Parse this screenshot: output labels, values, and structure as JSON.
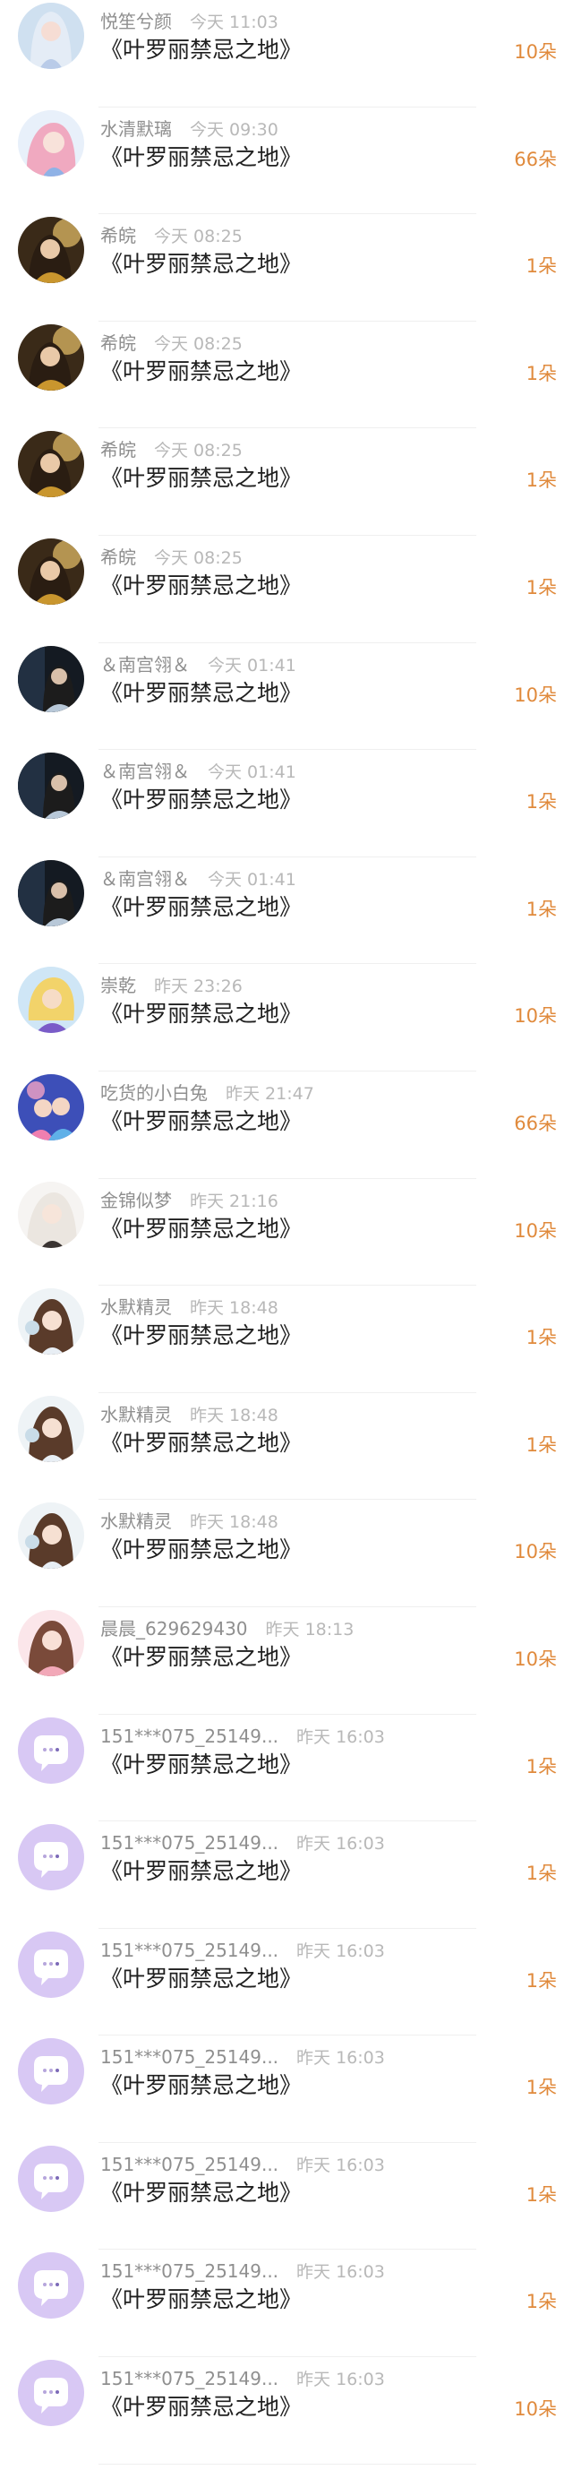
{
  "colors": {
    "amount": "#e08a3c",
    "name": "#8f8f8f",
    "time": "#b8b8b8",
    "title": "#1f1f1f",
    "placeholder_avatar": "#d8c8f4"
  },
  "rows": [
    {
      "name": "悦笙兮颜",
      "time": "今天 11:03",
      "title": "《叶罗丽禁忌之地》",
      "amount": "10朵",
      "avatar": "avatar-girl-silver-hair-icon"
    },
    {
      "name": "水清默璃",
      "time": "今天 09:30",
      "title": "《叶罗丽禁忌之地》",
      "amount": "66朵",
      "avatar": "avatar-girl-pink-hair-icon"
    },
    {
      "name": "希皖",
      "time": "今天 08:25",
      "title": "《叶罗丽禁忌之地》",
      "amount": "1朵",
      "avatar": "avatar-warrior-gold-icon"
    },
    {
      "name": "希皖",
      "time": "今天 08:25",
      "title": "《叶罗丽禁忌之地》",
      "amount": "1朵",
      "avatar": "avatar-warrior-gold-icon"
    },
    {
      "name": "希皖",
      "time": "今天 08:25",
      "title": "《叶罗丽禁忌之地》",
      "amount": "1朵",
      "avatar": "avatar-warrior-gold-icon"
    },
    {
      "name": "希皖",
      "time": "今天 08:25",
      "title": "《叶罗丽禁忌之地》",
      "amount": "1朵",
      "avatar": "avatar-warrior-gold-icon"
    },
    {
      "name": "＆南宫翎＆",
      "time": "今天 01:41",
      "title": "《叶罗丽禁忌之地》",
      "amount": "10朵",
      "avatar": "avatar-dark-portrait-icon"
    },
    {
      "name": "＆南宫翎＆",
      "time": "今天 01:41",
      "title": "《叶罗丽禁忌之地》",
      "amount": "1朵",
      "avatar": "avatar-dark-portrait-icon"
    },
    {
      "name": "＆南宫翎＆",
      "time": "今天 01:41",
      "title": "《叶罗丽禁忌之地》",
      "amount": "1朵",
      "avatar": "avatar-dark-portrait-icon"
    },
    {
      "name": "崇乾",
      "time": "昨天 23:26",
      "title": "《叶罗丽禁忌之地》",
      "amount": "10朵",
      "avatar": "avatar-blonde-hero-icon"
    },
    {
      "name": "吃货的小白兔",
      "time": "昨天 21:47",
      "title": "《叶罗丽禁忌之地》",
      "amount": "66朵",
      "avatar": "avatar-couple-blue-icon"
    },
    {
      "name": "金锦似梦",
      "time": "昨天 21:16",
      "title": "《叶罗丽禁忌之地》",
      "amount": "10朵",
      "avatar": "avatar-white-hair-girl-icon"
    },
    {
      "name": "水默精灵",
      "time": "昨天 18:48",
      "title": "《叶罗丽禁忌之地》",
      "amount": "1朵",
      "avatar": "avatar-brown-hair-girl-icon"
    },
    {
      "name": "水默精灵",
      "time": "昨天 18:48",
      "title": "《叶罗丽禁忌之地》",
      "amount": "1朵",
      "avatar": "avatar-brown-hair-girl-icon"
    },
    {
      "name": "水默精灵",
      "time": "昨天 18:48",
      "title": "《叶罗丽禁忌之地》",
      "amount": "10朵",
      "avatar": "avatar-brown-hair-girl-icon"
    },
    {
      "name": "晨晨_629629430",
      "time": "昨天 18:13",
      "title": "《叶罗丽禁忌之地》",
      "amount": "10朵",
      "avatar": "avatar-pink-girl-icon"
    },
    {
      "name": "151***075_25149...",
      "time": "昨天 16:03",
      "title": "《叶罗丽禁忌之地》",
      "amount": "1朵",
      "avatar": "default-chat-bubble-avatar-icon"
    },
    {
      "name": "151***075_25149...",
      "time": "昨天 16:03",
      "title": "《叶罗丽禁忌之地》",
      "amount": "1朵",
      "avatar": "default-chat-bubble-avatar-icon"
    },
    {
      "name": "151***075_25149...",
      "time": "昨天 16:03",
      "title": "《叶罗丽禁忌之地》",
      "amount": "1朵",
      "avatar": "default-chat-bubble-avatar-icon"
    },
    {
      "name": "151***075_25149...",
      "time": "昨天 16:03",
      "title": "《叶罗丽禁忌之地》",
      "amount": "1朵",
      "avatar": "default-chat-bubble-avatar-icon"
    },
    {
      "name": "151***075_25149...",
      "time": "昨天 16:03",
      "title": "《叶罗丽禁忌之地》",
      "amount": "1朵",
      "avatar": "default-chat-bubble-avatar-icon"
    },
    {
      "name": "151***075_25149...",
      "time": "昨天 16:03",
      "title": "《叶罗丽禁忌之地》",
      "amount": "1朵",
      "avatar": "default-chat-bubble-avatar-icon"
    },
    {
      "name": "151***075_25149...",
      "time": "昨天 16:03",
      "title": "《叶罗丽禁忌之地》",
      "amount": "10朵",
      "avatar": "default-chat-bubble-avatar-icon"
    }
  ]
}
